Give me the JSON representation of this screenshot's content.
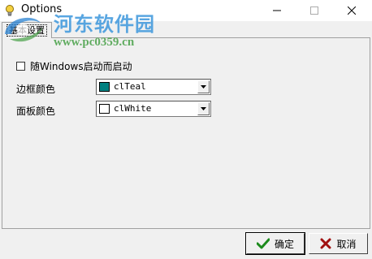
{
  "window": {
    "title": "Options"
  },
  "watermark": {
    "site_name": "河东软件园",
    "url": "www.pc0359.cn"
  },
  "tab": {
    "label": "基本设置"
  },
  "options": {
    "startup_checkbox": {
      "label": "随Windows启动而启动",
      "checked": false
    },
    "border_color": {
      "label": "边框颜色",
      "value": "clTeal",
      "swatch": "#008080"
    },
    "panel_color": {
      "label": "面板颜色",
      "value": "clWhite",
      "swatch": "#ffffff"
    }
  },
  "buttons": {
    "ok": {
      "label": "确定",
      "icon": "check-icon",
      "icon_color": "#1c8a1c"
    },
    "cancel": {
      "label": "取消",
      "icon": "x-icon",
      "icon_color": "#a01010"
    }
  }
}
